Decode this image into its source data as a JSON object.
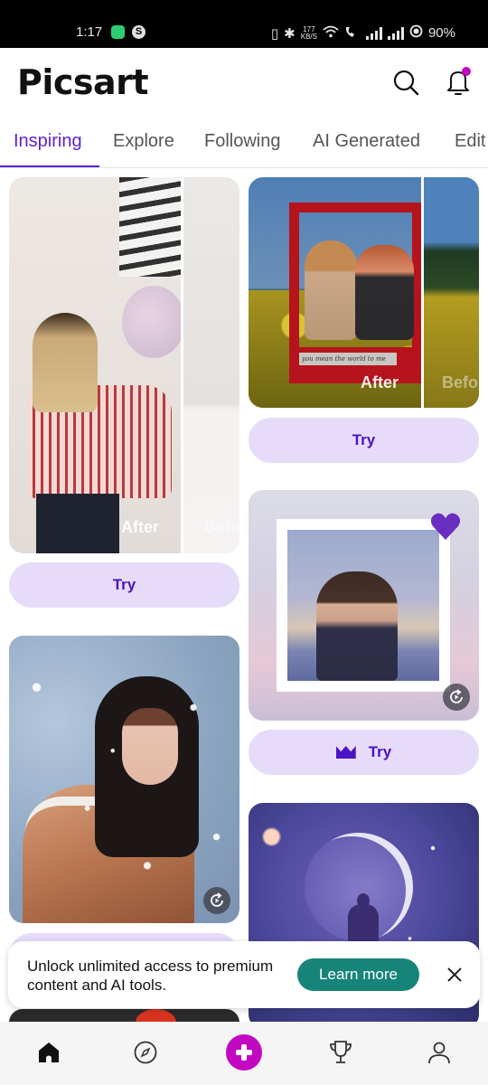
{
  "status_bar": {
    "time": "1:17",
    "network_speed_value": "177",
    "network_speed_unit": "KB/S",
    "battery": "90%"
  },
  "header": {
    "logo": "Picsart",
    "search_icon": "search-icon",
    "notifications_icon": "bell-icon",
    "notification_dot_color": "#c209c1"
  },
  "tabs": [
    {
      "label": "Inspiring",
      "active": true
    },
    {
      "label": "Explore",
      "active": false
    },
    {
      "label": "Following",
      "active": false
    },
    {
      "label": "AI Generated",
      "active": false
    },
    {
      "label": "Edit",
      "active": false
    }
  ],
  "accent_color": "#5a1fcf",
  "feed": {
    "cards": [
      {
        "id": "card-1",
        "after_label": "After",
        "before_label": "Befo",
        "try_label": "Try",
        "premium": false
      },
      {
        "id": "card-2",
        "after_label": "After",
        "before_label": "Befo",
        "caption": "you mean the world to me",
        "try_label": "Try",
        "premium": false
      },
      {
        "id": "card-3",
        "try_label": "Try",
        "premium": true,
        "replay_icon": "replay-icon"
      },
      {
        "id": "card-4",
        "replay_icon": "replay-icon"
      },
      {
        "id": "card-5"
      },
      {
        "id": "card-6"
      }
    ]
  },
  "promo": {
    "text": "Unlock unlimited access to premium content and AI tools.",
    "button_label": "Learn more",
    "button_color": "#168479",
    "close_icon": "close-icon"
  },
  "bottom_nav": {
    "items": [
      {
        "name": "home",
        "icon": "home-icon",
        "active": true
      },
      {
        "name": "explore",
        "icon": "compass-icon",
        "active": false
      },
      {
        "name": "create",
        "icon": "plus-icon",
        "active": false
      },
      {
        "name": "challenges",
        "icon": "trophy-icon",
        "active": false
      },
      {
        "name": "profile",
        "icon": "person-icon",
        "active": false
      }
    ],
    "create_color": "#c209c1"
  }
}
